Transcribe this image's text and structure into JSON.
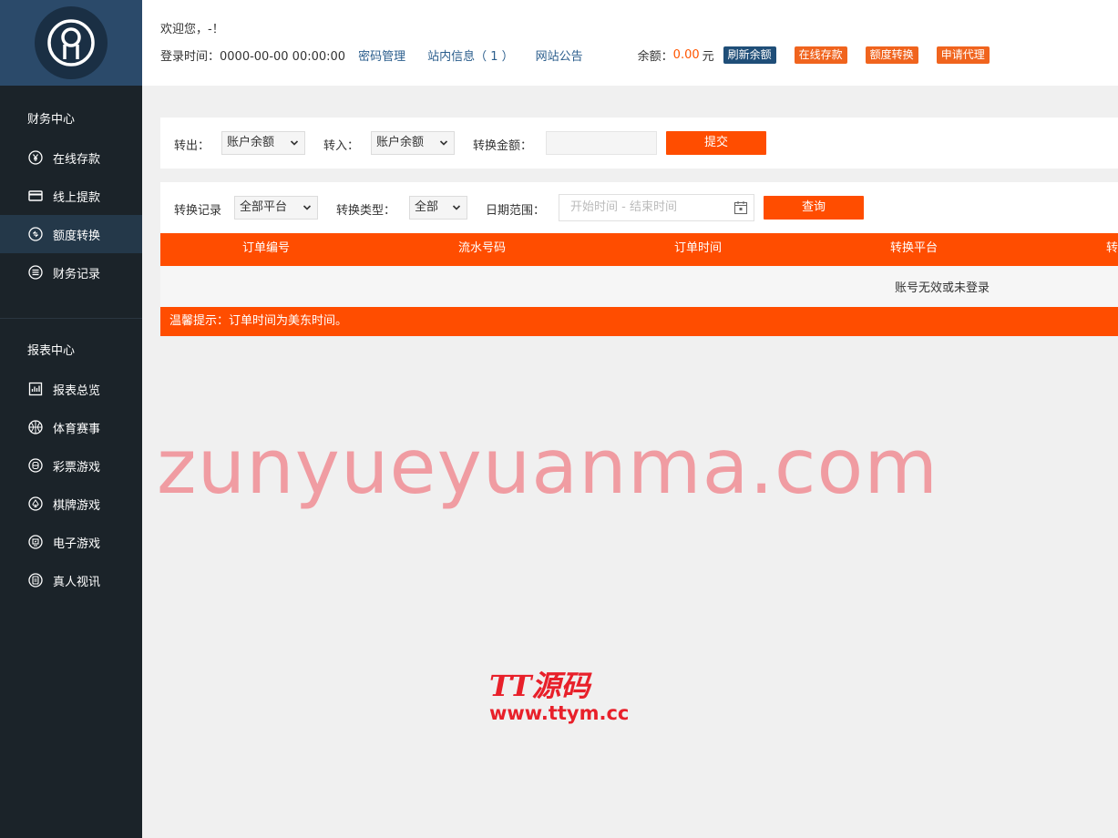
{
  "sidebar": {
    "section1_title": "财务中心",
    "section1_items": [
      {
        "label": "在线存款",
        "icon": "yen-circle-icon",
        "active": false
      },
      {
        "label": "线上提款",
        "icon": "card-icon",
        "active": false
      },
      {
        "label": "额度转换",
        "icon": "exchange-circle-icon",
        "active": true
      },
      {
        "label": "财务记录",
        "icon": "list-circle-icon",
        "active": false
      }
    ],
    "section2_title": "报表中心",
    "section2_items": [
      {
        "label": "报表总览",
        "icon": "chart-icon"
      },
      {
        "label": "体育赛事",
        "icon": "basketball-icon"
      },
      {
        "label": "彩票游戏",
        "icon": "lottery-icon"
      },
      {
        "label": "棋牌游戏",
        "icon": "spade-icon"
      },
      {
        "label": "电子游戏",
        "icon": "slot-icon"
      },
      {
        "label": "真人视讯",
        "icon": "live-icon"
      }
    ]
  },
  "header": {
    "welcome": "欢迎您，-！",
    "login_time": "登录时间：0000-00-00 00:00:00",
    "password_link": "密码管理",
    "messages_link": "站内信息（ 1 ）",
    "notice_link": "网站公告",
    "balance_label": "余额：",
    "balance_value": "0.00",
    "balance_unit": "元",
    "refresh_button": "刷新余额",
    "deposit_button": "在线存款",
    "transfer_button": "额度转换",
    "agent_button": "申请代理"
  },
  "transfer_form": {
    "out_label": "转出：",
    "out_value": "账户余额",
    "in_label": "转入：",
    "in_value": "账户余额",
    "amount_label": "转换金额：",
    "amount_value": "",
    "submit_label": "提交"
  },
  "records_filter": {
    "record_label": "转换记录",
    "platform_value": "全部平台",
    "type_label": "转换类型：",
    "type_value": "全部",
    "date_label": "日期范围：",
    "date_placeholder": "开始时间 - 结束时间",
    "query_label": "查询"
  },
  "table": {
    "columns": [
      "订单编号",
      "流水号码",
      "订单时间",
      "转换平台",
      "转"
    ],
    "empty_message": "账号无效或未登录",
    "tip": "温馨提示：订单时间为美东时间。"
  },
  "watermarks": {
    "big_text": "zunyueyuanma.com",
    "logo_title": "TT源码",
    "logo_url": "www.ttym.cc"
  },
  "colors": {
    "accent": "#ff4d00",
    "sidebar_bg": "#1b2329",
    "avatar_bg": "#2b4a6a",
    "link": "#2a5d8c"
  }
}
